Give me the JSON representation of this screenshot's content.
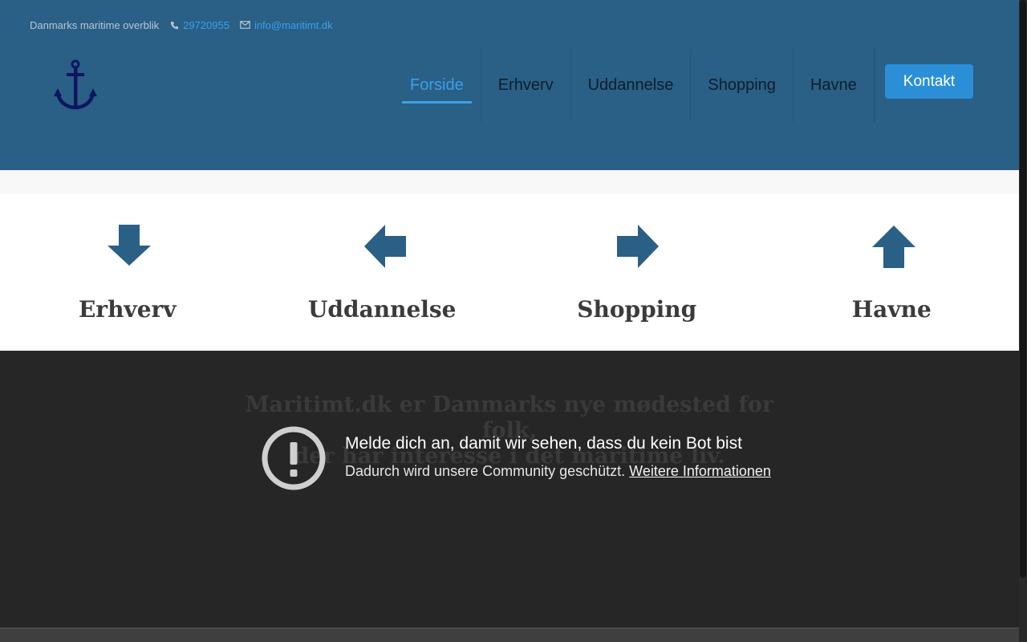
{
  "topbar": {
    "tagline": "Danmarks maritime overblik",
    "phone": "29720955",
    "email": "info@maritimt.dk"
  },
  "logo": {
    "icon": "anchor-icon"
  },
  "nav": {
    "items": [
      {
        "label": "Forside",
        "active": true
      },
      {
        "label": "Erhverv"
      },
      {
        "label": "Uddannelse"
      },
      {
        "label": "Shopping"
      },
      {
        "label": "Havne"
      }
    ],
    "contact_label": "Kontakt"
  },
  "cards": [
    {
      "title": "Erhverv",
      "icon": "arrow-down-icon"
    },
    {
      "title": "Uddannelse",
      "icon": "arrow-left-icon"
    },
    {
      "title": "Shopping",
      "icon": "arrow-right-icon"
    },
    {
      "title": "Havne",
      "icon": "arrow-up-icon"
    }
  ],
  "intro": {
    "line1": "Maritimt.dk er Danmarks nye mødested for folk,",
    "line2": "der har interesse i det maritime liv."
  },
  "notice": {
    "title": "Melde dich an, damit wir sehen, dass du kein Bot bist",
    "text": "Dadurch wird unsere Community geschützt.",
    "link": "Weitere Informationen"
  },
  "colors": {
    "header_bg": "#2a5f86",
    "accent": "#3aa0e6",
    "button": "#2b8fd8",
    "arrow": "#2a5f86",
    "dark_bg": "#262626"
  }
}
